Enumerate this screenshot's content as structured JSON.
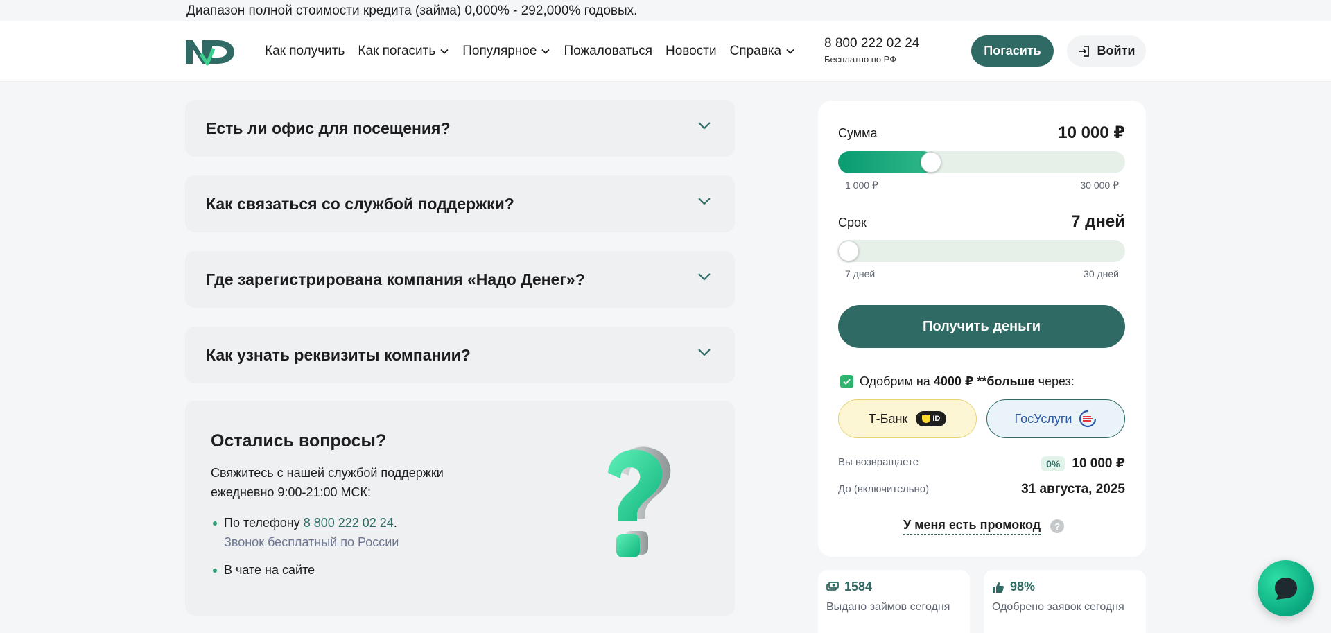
{
  "topbar": {
    "text": "Диапазон полной стоимости кредита (займа) 0,000% - 292,000% годовых."
  },
  "header": {
    "logo": "ND",
    "nav": [
      {
        "label": "Как получить",
        "dropdown": false
      },
      {
        "label": "Как погасить",
        "dropdown": true
      },
      {
        "label": "Популярное",
        "dropdown": true
      },
      {
        "label": "Пожаловаться",
        "dropdown": false
      },
      {
        "label": "Новости",
        "dropdown": false
      },
      {
        "label": "Справка",
        "dropdown": true
      }
    ],
    "phone": "8 800 222 02 24",
    "phone_note": "Бесплатно по РФ",
    "pay_label": "Погасить",
    "login_label": "Войти"
  },
  "faq": [
    {
      "question": "Есть ли офис для посещения?"
    },
    {
      "question": "Как связаться со службой поддержки?"
    },
    {
      "question": "Где зарегистрирована компания «Надо Денег»?"
    },
    {
      "question": "Как узнать реквизиты компании?"
    }
  ],
  "contact": {
    "title": "Остались вопросы?",
    "text": "Свяжитесь с нашей службой поддержки ежедневно 9:00-21:00 МСК:",
    "phone_prefix": "По телефону ",
    "phone_link": "8 800 222 02 24",
    "phone_suffix": ".",
    "phone_note": "Звонок бесплатный по России",
    "chat_item": "В чате на сайте"
  },
  "calculator": {
    "amount_label": "Сумма",
    "amount_value": "10 000 ₽",
    "amount_min": "1 000 ₽",
    "amount_max": "30 000 ₽",
    "amount_fraction": 0.31,
    "term_label": "Срок",
    "term_value": "7 дней",
    "term_min": "7 дней",
    "term_max": "30 дней",
    "term_fraction": 0,
    "get_money_label": "Получить деньги",
    "approve_prefix": "Одобрим на ",
    "approve_amount": "4000 ₽",
    "approve_more": " **больше",
    "approve_suffix": " через:",
    "tbank_label": "Т-Банк",
    "tbank_badge": "ID",
    "gos_label": "ГосУслуги",
    "return_label": "Вы возвращаете",
    "return_badge": "0%",
    "return_value": "10 000 ₽",
    "until_label": "До (включительно)",
    "until_value": "31 августа, 2025",
    "promo_label": "У меня есть промокод",
    "promo_help": "?"
  },
  "stats": [
    {
      "value": "1584",
      "label": "Выдано займов сегодня",
      "icon": "money-icon"
    },
    {
      "value": "98%",
      "label": "Одобрено заявок сегодня",
      "icon": "thumbs-up-icon"
    }
  ],
  "colors": {
    "brand": "#2f6b64",
    "accent": "#0a9b72"
  }
}
